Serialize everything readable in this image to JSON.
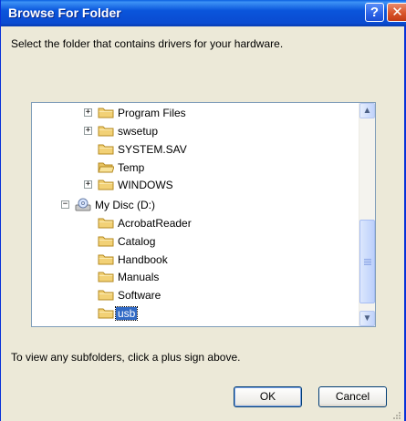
{
  "window": {
    "title": "Browse For Folder",
    "help_label": "?",
    "close_label": "✕"
  },
  "instruction": "Select the folder that contains drivers for your hardware.",
  "tree": {
    "nodes": [
      {
        "label": "Program Files",
        "expander": "+",
        "icon": "folder-icon"
      },
      {
        "label": "swsetup",
        "expander": "+",
        "icon": "folder-icon"
      },
      {
        "label": "SYSTEM.SAV",
        "expander": "",
        "icon": "folder-icon"
      },
      {
        "label": "Temp",
        "expander": "",
        "icon": "folder-open-icon"
      },
      {
        "label": "WINDOWS",
        "expander": "+",
        "icon": "folder-icon"
      },
      {
        "label": "My Disc (D:)",
        "expander": "−",
        "icon": "cd-drive-icon"
      },
      {
        "label": "AcrobatReader",
        "expander": "",
        "icon": "folder-icon"
      },
      {
        "label": "Catalog",
        "expander": "",
        "icon": "folder-icon"
      },
      {
        "label": "Handbook",
        "expander": "",
        "icon": "folder-icon"
      },
      {
        "label": "Manuals",
        "expander": "",
        "icon": "folder-icon"
      },
      {
        "label": "Software",
        "expander": "",
        "icon": "folder-icon"
      },
      {
        "label": "usb",
        "expander": "",
        "icon": "folder-icon",
        "selected": true
      }
    ]
  },
  "hint": "To view any subfolders, click a plus sign above.",
  "buttons": {
    "ok": "OK",
    "cancel": "Cancel"
  },
  "colors": {
    "title_bar": "#0a55db",
    "selection": "#316ac5",
    "folder": "#f2d176"
  }
}
